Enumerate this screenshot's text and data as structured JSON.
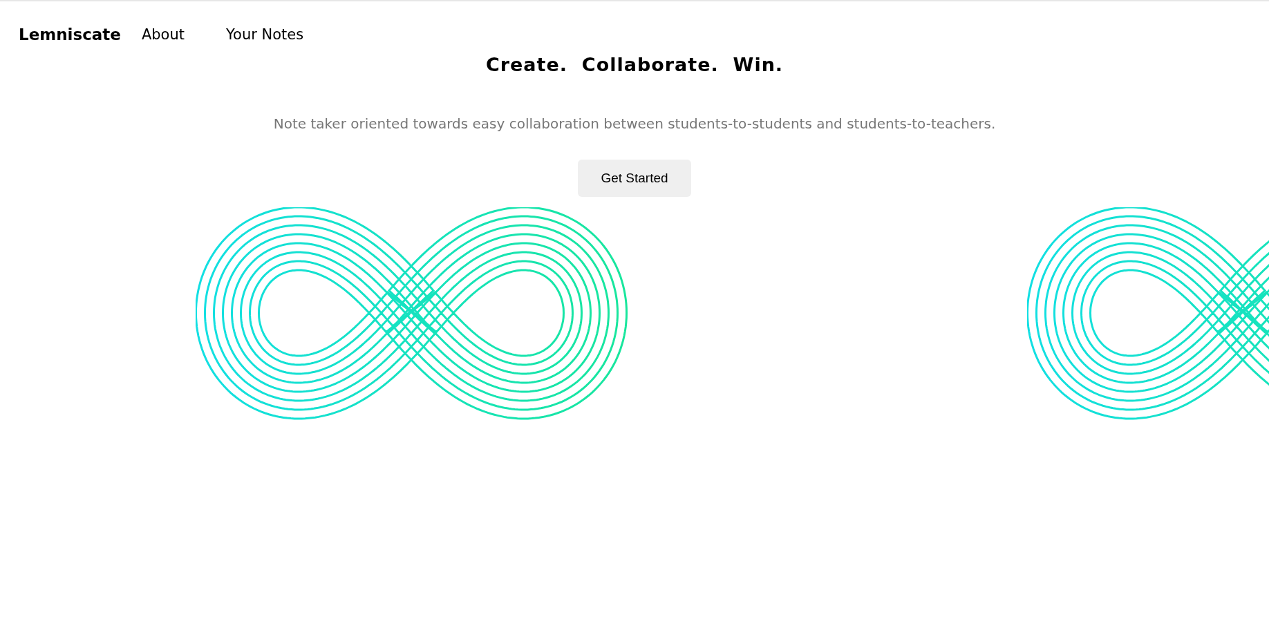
{
  "nav": {
    "brand": "Lemniscate",
    "links": [
      {
        "label": "About"
      },
      {
        "label": "Your Notes"
      }
    ]
  },
  "hero": {
    "title": "Create.  Collaborate.  Win.",
    "subtitle": "Note taker oriented towards easy collaboration between students-to-students and students-to-teachers.",
    "button": "Get Started"
  }
}
